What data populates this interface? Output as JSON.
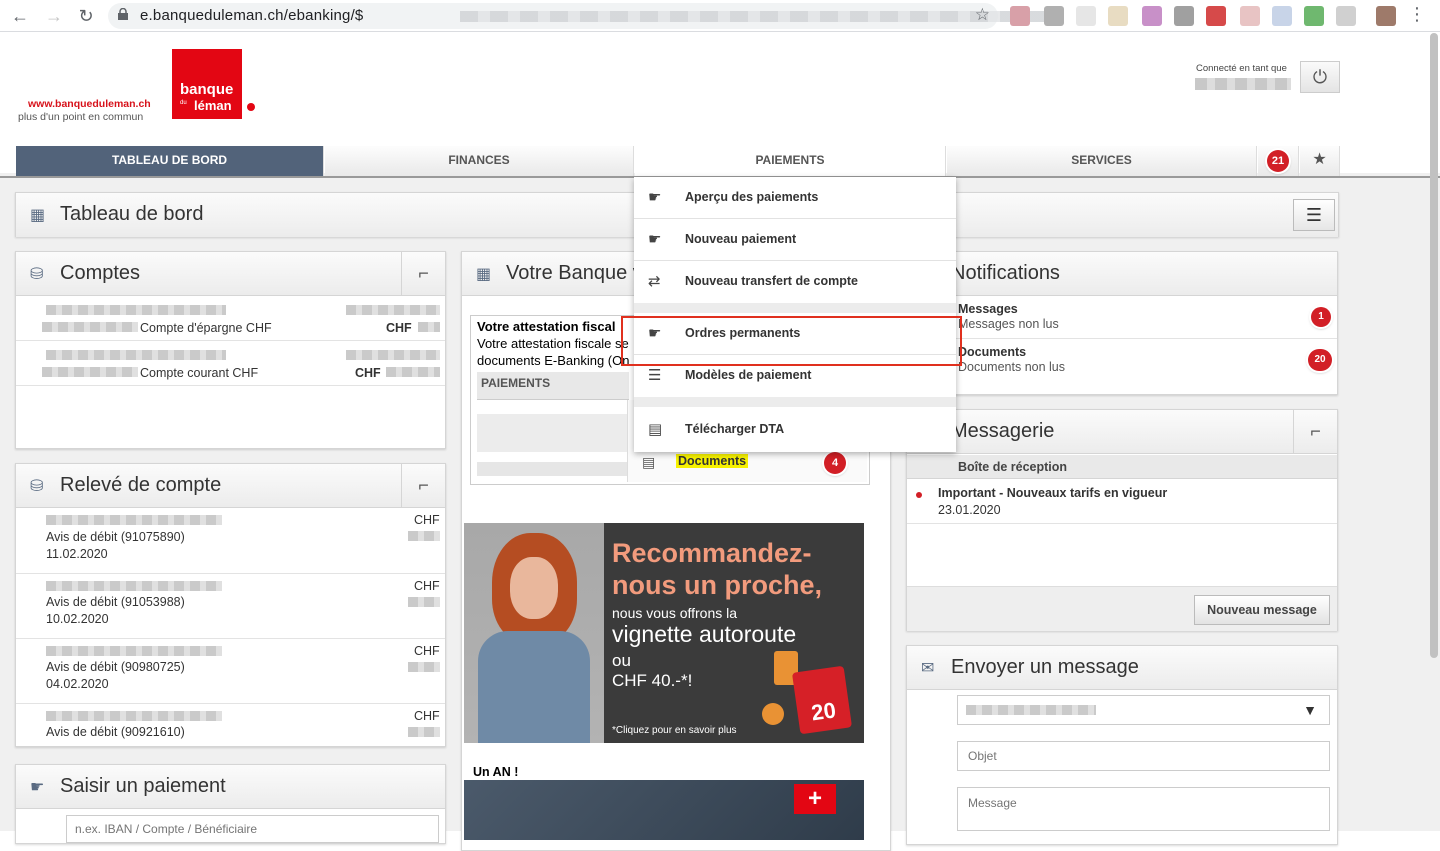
{
  "browser": {
    "url": "e.banqueduleman.ch/ebanking/$"
  },
  "header": {
    "logo_url": "www.banqueduleman.ch",
    "logo_tagline": "plus d'un point en commun",
    "logo_line1": "banque",
    "logo_du": "du",
    "logo_line2": "léman",
    "connected_label": "Connecté en tant que"
  },
  "menu": {
    "tabs": [
      {
        "label": "TABLEAU DE BORD"
      },
      {
        "label": "FINANCES"
      },
      {
        "label": "PAIEMENTS"
      },
      {
        "label": "SERVICES"
      }
    ],
    "badge_count": "21"
  },
  "dashboard_title": "Tableau de bord",
  "comptes": {
    "title": "Comptes",
    "rows": [
      {
        "name": "Compte d'épargne CHF",
        "currency": "CHF"
      },
      {
        "name": "Compte courant CHF",
        "currency": "CHF"
      }
    ]
  },
  "releve": {
    "title": "Relevé de compte",
    "rows": [
      {
        "label": "Avis de débit (91075890)",
        "date": "11.02.2020",
        "currency": "CHF"
      },
      {
        "label": "Avis de débit (91053988)",
        "date": "10.02.2020",
        "currency": "CHF"
      },
      {
        "label": "Avis de débit (90980725)",
        "date": "04.02.2020",
        "currency": "CHF"
      },
      {
        "label": "Avis de débit (90921610)",
        "date": "",
        "currency": "CHF"
      }
    ]
  },
  "saisir": {
    "title": "Saisir un paiement",
    "placeholder": "n.ex. IBAN / Compte / Bénéficiaire"
  },
  "banque": {
    "title": "Votre Banque v",
    "attest_title": "Votre attestation fiscal",
    "attest_text1": "Votre attestation fiscale se",
    "attest_text2": "documents E-Banking (On",
    "paiements_label": "PAIEMENTS",
    "documents_label": "Documents",
    "documents_count": "4"
  },
  "ad": {
    "headline1": "Recommandez-",
    "headline2": "nous un proche,",
    "line1": "nous vous offrons la",
    "line2": "vignette autoroute",
    "line3": "ou",
    "line4": "CHF 40.-*!",
    "footnote": "*Cliquez pour en savoir plus",
    "vignette_year": "20"
  },
  "un_an": "Un AN !",
  "notifications": {
    "title": "Notifications",
    "items": [
      {
        "title": "Messages",
        "sub": "Messages non lus",
        "count": "1"
      },
      {
        "title": "Documents",
        "sub": "Documents non lus",
        "count": "20"
      }
    ]
  },
  "messagerie": {
    "title": "Messagerie",
    "inbox_label": "Boîte de réception",
    "message_title": "Important - Nouveaux tarifs en vigueur",
    "message_date": "23.01.2020",
    "new_button": "Nouveau message"
  },
  "envoyer": {
    "title": "Envoyer un message",
    "objet_placeholder": "Objet",
    "message_placeholder": "Message"
  },
  "paiements_menu": {
    "items": [
      {
        "label": "Aperçu des paiements"
      },
      {
        "label": "Nouveau paiement"
      },
      {
        "label": "Nouveau transfert de compte"
      },
      {
        "label": "Ordres permanents"
      },
      {
        "label": "Modèles de paiement"
      },
      {
        "label": "Télécharger DTA"
      }
    ]
  }
}
